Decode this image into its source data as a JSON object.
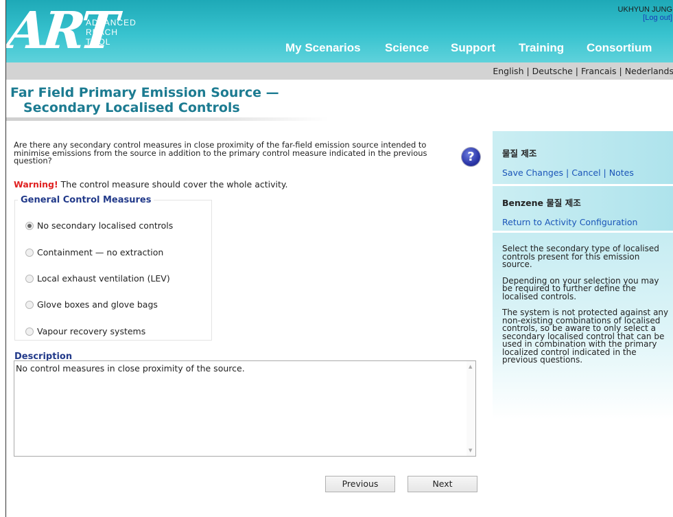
{
  "header": {
    "logo_art": "ART",
    "logo_line1": "ADVANCED",
    "logo_line2": "REACH",
    "logo_line3": "TOOL",
    "user_name": "UKHYUN JUNG",
    "logout": "[Log out]",
    "nav": [
      "My Scenarios",
      "Science",
      "Support",
      "Training",
      "Consortium"
    ]
  },
  "languages": {
    "items": [
      "English",
      "Deutsche",
      "Francais",
      "Nederlands"
    ],
    "separator": " | "
  },
  "page": {
    "title_line1": "Far Field Primary Emission Source  —",
    "title_line2": "Secondary Localised Controls"
  },
  "question": {
    "text": "Are there any secondary control measures in close proximity of the far-field emission source intended to minimise emissions from the source in addition to the primary control measure indicated in the previous question?",
    "help_glyph": "?",
    "warning_label": "Warning!",
    "warning_text": " The control measure should cover the whole activity."
  },
  "controls": {
    "legend": "General Control Measures",
    "options": [
      {
        "label": "No secondary localised controls",
        "selected": true
      },
      {
        "label": "Containment — no extraction",
        "selected": false
      },
      {
        "label": "Local exhaust ventilation (LEV)",
        "selected": false
      },
      {
        "label": "Glove boxes and glove bags",
        "selected": false
      },
      {
        "label": "Vapour recovery systems",
        "selected": false
      }
    ]
  },
  "description": {
    "label": "Description",
    "text": "No control measures in close proximity of the source."
  },
  "buttons": {
    "previous": "Previous",
    "next": "Next"
  },
  "sidebar": {
    "scenario_name": "물질 제조",
    "save_changes": "Save Changes",
    "cancel": "Cancel",
    "notes": "Notes",
    "separator": " | ",
    "substance": "Benzene",
    "activity": " 물질 제조",
    "return_link": "Return to Activity Configuration",
    "help_paragraphs": [
      "Select the secondary type of localised controls present for this emission source.",
      "Depending on your selection you may be required to further define the localised controls.",
      "The system is not protected against any non-existing combinations of localised controls, so be aware to only select a secondary localised control that can be used in combination with the primary localized control indicated in the previous questions."
    ]
  },
  "colors": {
    "header_teal": "#2fb8c6",
    "title_teal": "#1c7b91",
    "link_blue": "#1a55b8",
    "warning_red": "#e02020",
    "legend_navy": "#223a8a"
  }
}
